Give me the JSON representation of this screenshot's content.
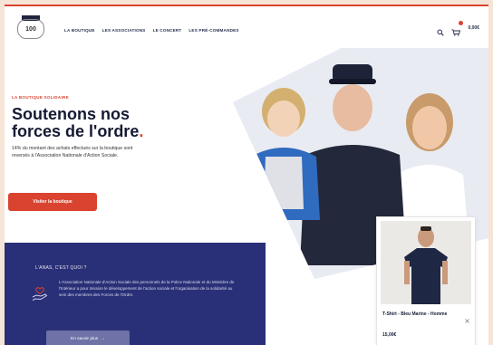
{
  "header": {
    "logo_top": "",
    "logo_text": "100",
    "nav": [
      "LA BOUTIQUE",
      "LES ASSOCIATIONS",
      "LE CONCERT",
      "LES PRÉ-COMMANDES"
    ],
    "cart_total": "0,00€"
  },
  "hero": {
    "kicker": "LA BOUTIQUE SOLIDAIRE",
    "headline_line1": "Soutenons nos",
    "headline_line2": "forces de l'ordre",
    "headline_dot": ".",
    "paragraph": "14% du montant des achats effectués sur la boutique sont reversés à l'Association Nationale d'Action Sociale.",
    "cta_label": "Visiter la boutique"
  },
  "promo": {
    "kicker": "L'ANAS, C'EST QUOI ?",
    "text": "L'Association Nationale d'Action Sociale des personnels de la Police Nationale et du Ministère de l'Intérieur a pour mission le développement de l'action sociale et l'organisation de la solidarité au sein des membres des Forces de l'Ordre.",
    "button_label": "En savoir plus",
    "button_arrow": "→"
  },
  "product": {
    "name": "T-Shirt - Bleu Marine - Homme",
    "price": "15,00€",
    "close": "×"
  },
  "colors": {
    "accent": "#d9432f",
    "navy": "#151a33",
    "promo_bg": "#2a3077"
  }
}
